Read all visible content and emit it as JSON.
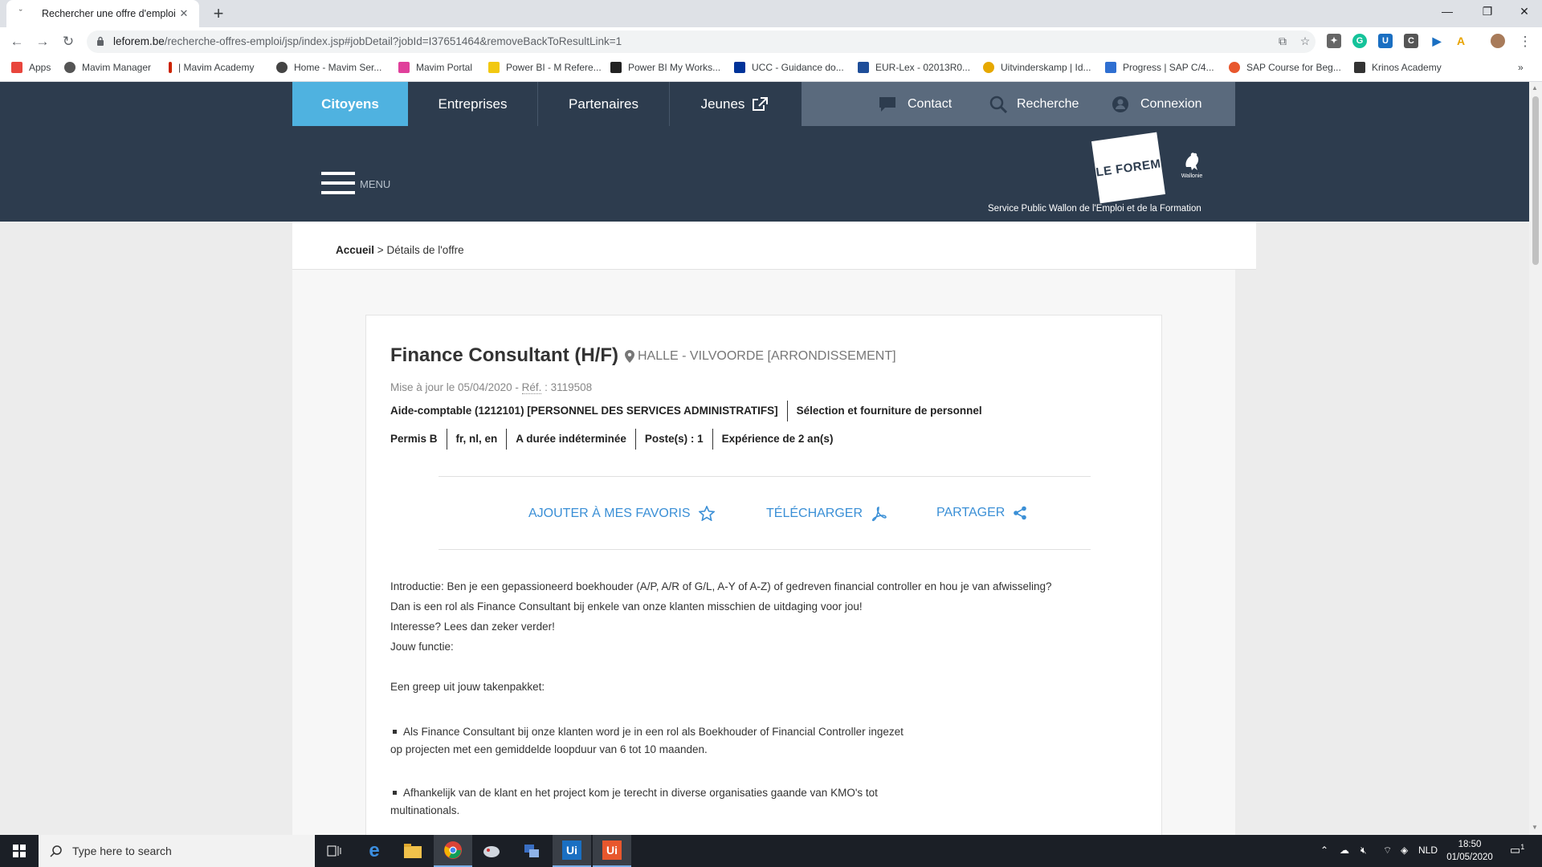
{
  "browser": {
    "tab_title": "Rechercher une offre d'emploi",
    "url_host": "leforem.be",
    "url_path": "/recherche-offres-emploi/jsp/index.jsp#jobDetail?jobId=I37651464&removeBackToResultLink=1",
    "new_tab_symbol": "+",
    "icons": [
      "back-icon",
      "forward-icon",
      "reload-icon",
      "lock-icon",
      "translate-icon",
      "star-icon",
      "extensions-icon",
      "profile-icon",
      "more-icon"
    ],
    "bookmarks": [
      {
        "label": "Apps",
        "color": "#e8453c"
      },
      {
        "label": "Mavim Manager",
        "color": "#555555"
      },
      {
        "label": "| Mavim Academy",
        "color": "#cc2200"
      },
      {
        "label": "Home - Mavim Ser...",
        "color": "#444444"
      },
      {
        "label": "Mavim Portal",
        "color": "#e0409b"
      },
      {
        "label": "Power BI - M Refere...",
        "color": "#f2c811"
      },
      {
        "label": "Power BI My Works...",
        "color": "#222222"
      },
      {
        "label": "UCC - Guidance do...",
        "color": "#003399"
      },
      {
        "label": "EUR-Lex - 02013R0...",
        "color": "#1f4e99"
      },
      {
        "label": "Uitvinderskamp | Id...",
        "color": "#e6a800"
      },
      {
        "label": "Progress | SAP C/4...",
        "color": "#2f6fd1"
      },
      {
        "label": "SAP Course for Beg...",
        "color": "#e8572d"
      },
      {
        "label": "Krinos Academy",
        "color": "#333333"
      }
    ],
    "bookmarks_overflow": "»"
  },
  "site": {
    "nav": {
      "citoyens": "Citoyens",
      "entreprises": "Entreprises",
      "partenaires": "Partenaires",
      "jeunes": "Jeunes",
      "contact": "Contact",
      "recherche": "Recherche",
      "connexion": "Connexion"
    },
    "menu_label": "MENU",
    "logo_text": "LE FOREM",
    "region_label": "Wallonie",
    "service_line": "Service Public Wallon de l'Emploi et de la Formation",
    "colors": {
      "header": "#2d3c4e",
      "accent": "#4fb2e0",
      "link": "#3a8fd6"
    }
  },
  "breadcrumb": {
    "home": "Accueil",
    "separator": ">",
    "current": "Détails de l'offre"
  },
  "job": {
    "title": "Finance Consultant (H/F)",
    "location": "HALLE - VILVOORDE [ARRONDISSEMENT]",
    "updated_prefix": "Mise à jour le 05/04/2020 - ",
    "ref_label": "Réf.",
    "ref_value": " : 3119508",
    "category_row": [
      "Aide-comptable (1212101) [PERSONNEL DES SERVICES ADMINISTRATIFS]",
      "Sélection et fourniture de personnel"
    ],
    "details_row": [
      "Permis B",
      "fr, nl, en",
      "A durée indéterminée",
      "Poste(s) : 1",
      "Expérience de 2 an(s)"
    ],
    "actions": {
      "favorite": "AJOUTER À MES FAVORIS",
      "download": "TÉLÉCHARGER",
      "share": "PARTAGER"
    },
    "description_lines": [
      "Introductie: Ben je een gepassioneerd boekhouder (A/P, A/R of G/L, A-Y of A-Z) of gedreven financial controller en hou je van afwisseling?",
      "Dan is een rol als Finance Consultant bij enkele van onze klanten misschien de uitdaging voor jou!",
      "Interesse? Lees dan zeker verder!",
      "Jouw functie:",
      "",
      "Een greep uit jouw takenpakket:"
    ],
    "bullets": [
      {
        "line1": "Als Finance Consultant bij onze klanten word je in een rol als Boekhouder of Financial Controller ingezet",
        "line2": "op projecten met een gemiddelde loopduur van 6 tot 10 maanden."
      },
      {
        "line1": "Afhankelijk van de klant en het project kom je terecht in diverse organisaties gaande van KMO's tot",
        "line2": "multinationals."
      }
    ]
  },
  "taskbar": {
    "search_placeholder": "Type here to search",
    "language": "NLD",
    "time": "18:50",
    "date": "01/05/2020",
    "notification_count": "1"
  }
}
